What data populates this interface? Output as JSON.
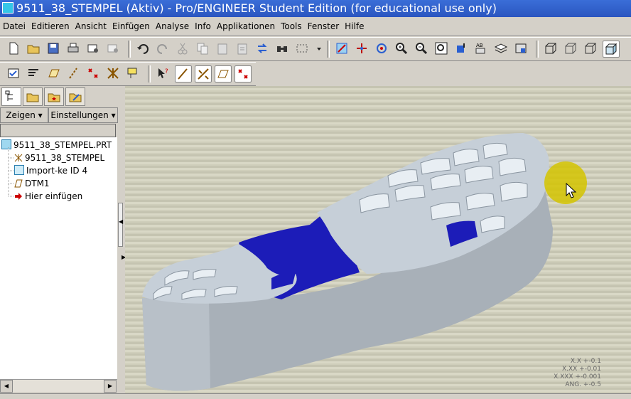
{
  "window": {
    "title": "9511_38_STEMPEL (Aktiv) - Pro/ENGINEER Student Edition (for educational use only)"
  },
  "menu": [
    "Datei",
    "Editieren",
    "Ansicht",
    "Einfügen",
    "Analyse",
    "Info",
    "Applikationen",
    "Tools",
    "Fenster",
    "Hilfe"
  ],
  "navigator": {
    "show_label": "Zeigen",
    "settings_label": "Einstellungen",
    "tree": [
      {
        "label": "9511_38_STEMPEL.PRT",
        "icon": "part-icon"
      },
      {
        "label": "9511_38_STEMPEL",
        "icon": "datum-csys-icon"
      },
      {
        "label": "Import-ke ID 4",
        "icon": "import-feature-icon"
      },
      {
        "label": "DTM1",
        "icon": "datum-plane-icon"
      },
      {
        "label": "Hier einfügen",
        "icon": "insert-here-arrow-icon"
      }
    ]
  },
  "viewport": {
    "tolerances": [
      "X.X +-0.1",
      "X.XX +-0.01",
      "X.XXX +-0.001",
      "ANG. +-0.5"
    ]
  },
  "colors": {
    "title_bar": "#2a55c0",
    "model_body": "#a9b1b8",
    "model_blue": "#1c1cb8",
    "cursor_highlight": "#d4c400"
  }
}
